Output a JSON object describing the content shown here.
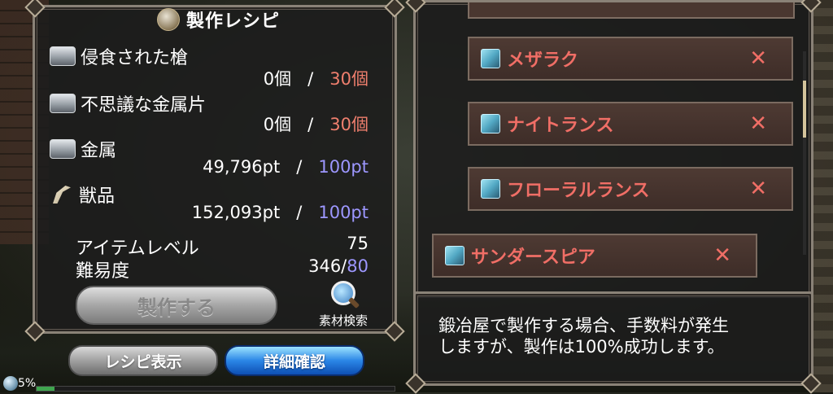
{
  "panel": {
    "title": "製作レシピ",
    "title_icon": "anvil-hammer-icon"
  },
  "materials": [
    {
      "icon": "ingot-icon",
      "name": "侵食された槍",
      "have": "0個",
      "sep": "/",
      "need": "30個",
      "need_color": "#f07f6e"
    },
    {
      "icon": "ingot-icon",
      "name": "不思議な金属片",
      "have": "0個",
      "sep": "/",
      "need": "30個",
      "need_color": "#f07f6e"
    },
    {
      "icon": "ingot-icon",
      "name": "金属",
      "have": "49,796pt",
      "sep": "/",
      "need": "100pt",
      "need_color": "#9d97ff"
    },
    {
      "icon": "fang-icon",
      "name": "獣品",
      "have": "152,093pt",
      "sep": "/",
      "need": "100pt",
      "need_color": "#9d97ff"
    }
  ],
  "stats": {
    "item_level_label": "アイテムレベル",
    "item_level_value": "75",
    "difficulty_label": "難易度",
    "difficulty_value": "346/",
    "difficulty_max": "80"
  },
  "buttons": {
    "craft": "製作する",
    "search_label": "素材検索",
    "recipe_view": "レシピ表示",
    "detail": "詳細確認"
  },
  "status": {
    "percent_text": "5%",
    "progress": 0.05
  },
  "recipe_list": [
    {
      "name": "メザラク",
      "status_icon": "cross-icon",
      "mark": "✕"
    },
    {
      "name": "ナイトランス",
      "status_icon": "cross-icon",
      "mark": "✕"
    },
    {
      "name": "フローラルランス",
      "status_icon": "cross-icon",
      "mark": "✕"
    },
    {
      "name": "サンダースピア",
      "status_icon": "cross-icon",
      "mark": "✕",
      "selected": true
    }
  ],
  "info": {
    "text": "鍛冶屋で製作する場合、手数料が発生\nしますが、製作は100%成功します。"
  },
  "colors": {
    "unavailable": "#f06e66",
    "accent_blue": "#9d97ff"
  }
}
